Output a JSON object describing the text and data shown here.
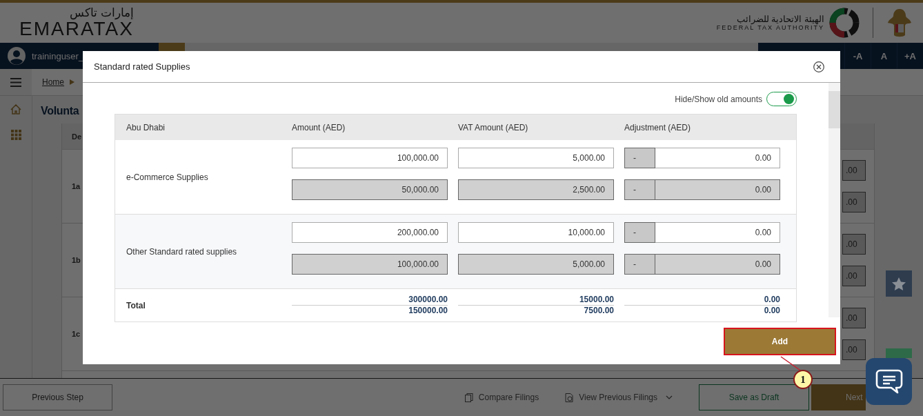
{
  "header": {
    "logo_arabic": "إمارات تاكس",
    "logo_text": "EMARATAX",
    "authority_arabic": "الهيئة الاتحادية للضرائب",
    "authority_name": "FEDERAL TAX AUTHORITY"
  },
  "user_bar": {
    "username": "traininguser_",
    "font_buttons": [
      "-A",
      "A",
      "+A"
    ]
  },
  "breadcrumb": [
    {
      "label": "Home"
    }
  ],
  "page_title": "Volunta",
  "background_table": {
    "header": "De",
    "rows": [
      {
        "label": "1a",
        "values": [
          ".00",
          ".00"
        ]
      },
      {
        "label": "1b",
        "values": [
          ".00",
          ".00"
        ]
      },
      {
        "label": "1c",
        "values": [
          ".00",
          ".00"
        ]
      }
    ]
  },
  "modal": {
    "title": "Standard rated Supplies",
    "toggle": {
      "label": "Hide/Show old amounts",
      "on": true
    },
    "columns": [
      "Abu Dhabi",
      "Amount (AED)",
      "VAT Amount (AED)",
      "Adjustment (AED)"
    ],
    "rows": [
      {
        "label": "e-Commerce Supplies",
        "lines": [
          {
            "kind": "current",
            "amount": "100,000.00",
            "vat": "5,000.00",
            "sign": "-",
            "adjustment": "0.00"
          },
          {
            "kind": "old",
            "amount": "50,000.00",
            "vat": "2,500.00",
            "sign": "-",
            "adjustment": "0.00"
          }
        ]
      },
      {
        "label": "Other Standard rated supplies",
        "lines": [
          {
            "kind": "current",
            "amount": "200,000.00",
            "vat": "10,000.00",
            "sign": "-",
            "adjustment": "0.00"
          },
          {
            "kind": "old",
            "amount": "100,000.00",
            "vat": "5,000.00",
            "sign": "-",
            "adjustment": "0.00"
          }
        ]
      }
    ],
    "total": {
      "label": "Total",
      "amount": [
        "300000.00",
        "150000.00"
      ],
      "vat": [
        "15000.00",
        "7500.00"
      ],
      "adjustment": [
        "0.00",
        "0.00"
      ]
    },
    "add_button": "Add"
  },
  "footer": {
    "previous": "Previous Step",
    "compare": "Compare Filings",
    "view_previous": "View Previous Filings",
    "save_draft": "Save as Draft",
    "next": "Next"
  },
  "annotation": "1"
}
